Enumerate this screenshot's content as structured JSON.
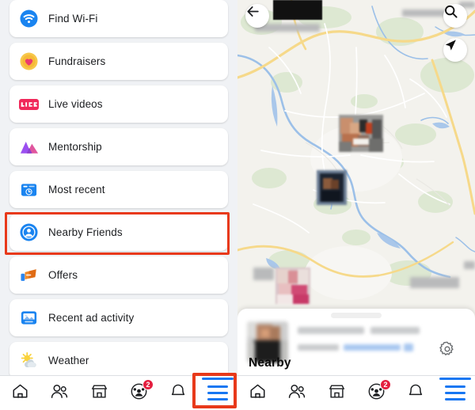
{
  "menu": {
    "items": [
      {
        "label": "Find Wi-Fi",
        "icon": "wifi-icon"
      },
      {
        "label": "Fundraisers",
        "icon": "heart-icon"
      },
      {
        "label": "Live videos",
        "icon": "live-badge-icon"
      },
      {
        "label": "Mentorship",
        "icon": "mountains-icon"
      },
      {
        "label": "Most recent",
        "icon": "clock-calendar-icon"
      },
      {
        "label": "Nearby Friends",
        "icon": "nearby-friends-icon"
      },
      {
        "label": "Offers",
        "icon": "offers-tag-icon"
      },
      {
        "label": "Recent ad activity",
        "icon": "ad-activity-icon"
      },
      {
        "label": "Weather",
        "icon": "sun-cloud-icon"
      }
    ],
    "highlighted_item": "Nearby Friends"
  },
  "bottom_nav": {
    "items": [
      {
        "name": "home",
        "icon": "home-icon",
        "badge": ""
      },
      {
        "name": "friends",
        "icon": "friends-icon",
        "badge": ""
      },
      {
        "name": "marketplace",
        "icon": "marketplace-icon",
        "badge": ""
      },
      {
        "name": "groups",
        "icon": "groups-icon",
        "badge": "2"
      },
      {
        "name": "notifications",
        "icon": "bell-icon",
        "badge": ""
      },
      {
        "name": "menu",
        "icon": "hamburger-icon",
        "badge": ""
      }
    ],
    "active": "menu"
  },
  "map_panel": {
    "back_icon": "back-arrow-icon",
    "search_icon": "search-icon",
    "locate_icon": "locate-arrow-icon",
    "settings_icon": "gear-icon",
    "sheet_title": "Nearby",
    "profile_name": "",
    "profile_status": "",
    "friend_pins": 3
  },
  "colors": {
    "highlight": "#e8391a",
    "facebook_blue": "#1877f2",
    "badge_red": "#e41e3f",
    "page_bg": "#f0f2f5",
    "map_land": "#f2f1ec",
    "map_green": "#dfe9d4",
    "map_water": "#a8c5e8",
    "map_road": "#f6d98a"
  }
}
